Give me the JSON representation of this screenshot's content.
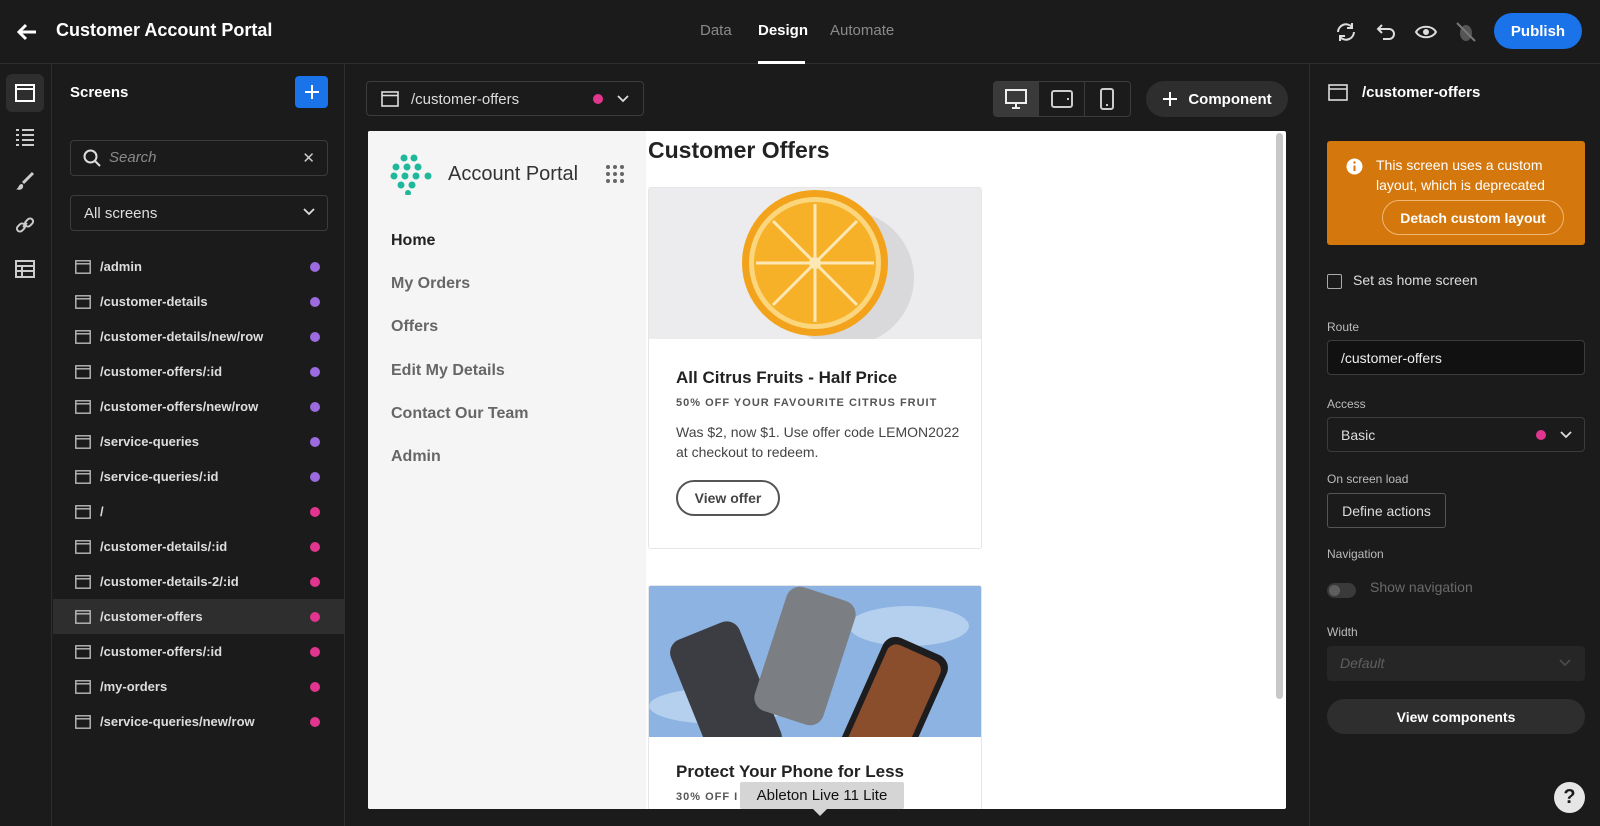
{
  "header": {
    "title": "Customer Account Portal",
    "tabs": [
      {
        "label": "Data",
        "active": false
      },
      {
        "label": "Design",
        "active": true
      },
      {
        "label": "Automate",
        "active": false
      }
    ],
    "publish_label": "Publish"
  },
  "icons": {
    "back": "arrow-left-icon",
    "sync": "refresh-icon",
    "undo": "undo-icon",
    "preview": "eye-icon",
    "bug": "bug-off-icon"
  },
  "colors": {
    "accent": "#1a73e8",
    "dot_purple": "#9b6bdf",
    "dot_pink": "#e2358f",
    "warning": "#d4770c"
  },
  "screens": {
    "title": "Screens",
    "search_placeholder": "Search",
    "filter_label": "All screens",
    "items": [
      {
        "route": "/admin",
        "dot": "#9b6bdf"
      },
      {
        "route": "/customer-details",
        "dot": "#9b6bdf"
      },
      {
        "route": "/customer-details/new/row",
        "dot": "#9b6bdf"
      },
      {
        "route": "/customer-offers/:id",
        "dot": "#9b6bdf"
      },
      {
        "route": "/customer-offers/new/row",
        "dot": "#9b6bdf"
      },
      {
        "route": "/service-queries",
        "dot": "#9b6bdf"
      },
      {
        "route": "/service-queries/:id",
        "dot": "#9b6bdf"
      },
      {
        "route": "/",
        "dot": "#e2358f"
      },
      {
        "route": "/customer-details/:id",
        "dot": "#e2358f"
      },
      {
        "route": "/customer-details-2/:id",
        "dot": "#e2358f"
      },
      {
        "route": "/customer-offers",
        "dot": "#e2358f",
        "selected": true
      },
      {
        "route": "/customer-offers/:id",
        "dot": "#e2358f"
      },
      {
        "route": "/my-orders",
        "dot": "#e2358f"
      },
      {
        "route": "/service-queries/new/row",
        "dot": "#e2358f"
      }
    ]
  },
  "canvas": {
    "route_select": "/customer-offers",
    "add_component_label": "Component",
    "tooltip": "Ableton Live 11 Lite"
  },
  "preview": {
    "brand": "Account Portal",
    "nav": [
      "Home",
      "My Orders",
      "Offers",
      "Edit My Details",
      "Contact Our Team",
      "Admin"
    ],
    "heading": "Customer Offers",
    "cards": [
      {
        "title": "All Citrus Fruits - Half Price",
        "subtitle": "50% OFF YOUR FAVOURITE CITRUS FRUIT",
        "description": "Was $2, now $1.  Use offer code LEMON2022 at checkout to redeem.",
        "button": "View offer"
      },
      {
        "title": "Protect Your Phone for Less",
        "subtitle": "30% OFF I"
      }
    ]
  },
  "settings": {
    "title": "/customer-offers",
    "warning": "This screen uses a custom layout, which is deprecated",
    "detach_label": "Detach custom layout",
    "home_label": "Set as home screen",
    "route_label": "Route",
    "route_value": "/customer-offers",
    "access_label": "Access",
    "access_value": "Basic",
    "on_load_label": "On screen load",
    "define_actions": "Define actions",
    "navigation_label": "Navigation",
    "show_navigation": "Show navigation",
    "width_label": "Width",
    "width_value": "Default",
    "view_components": "View components"
  },
  "help_label": "?"
}
